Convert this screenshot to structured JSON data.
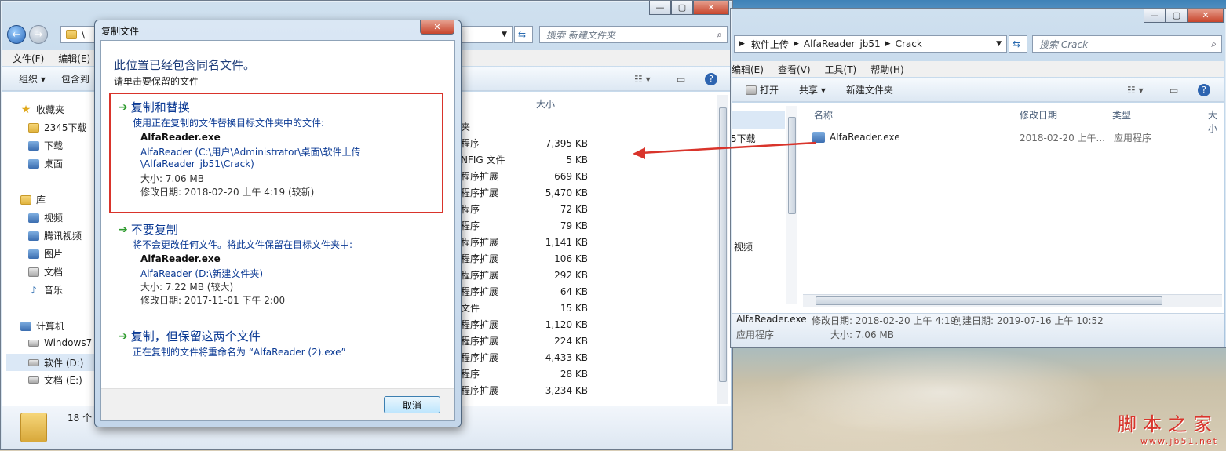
{
  "left_window": {
    "address_partial": "\\",
    "search_placeholder": "搜索 新建文件夹",
    "menu": [
      "文件(F)",
      "编辑(E)"
    ],
    "toolbar": {
      "organize": "组织 ▾",
      "include": "包含到"
    },
    "nav": {
      "favorites": "收藏夹",
      "fav_items": [
        "2345下载",
        "下载",
        "桌面"
      ],
      "library": "库",
      "lib_items": [
        "视频",
        "腾讯视频",
        "图片",
        "文档",
        "音乐"
      ],
      "computer": "计算机",
      "drives": [
        "Windows7",
        "软件 (D:)",
        "文档 (E:)"
      ]
    },
    "size_header": "大小",
    "rows": [
      {
        "type": "夹",
        "size": ""
      },
      {
        "type": "程序",
        "size": "7,395 KB"
      },
      {
        "type": "NFIG 文件",
        "size": "5 KB"
      },
      {
        "type": "程序扩展",
        "size": "669 KB"
      },
      {
        "type": "程序扩展",
        "size": "5,470 KB"
      },
      {
        "type": "程序",
        "size": "72 KB"
      },
      {
        "type": "程序",
        "size": "79 KB"
      },
      {
        "type": "程序扩展",
        "size": "1,141 KB"
      },
      {
        "type": "程序扩展",
        "size": "106 KB"
      },
      {
        "type": "程序扩展",
        "size": "292 KB"
      },
      {
        "type": "程序扩展",
        "size": "64 KB"
      },
      {
        "type": "文件",
        "size": "15 KB"
      },
      {
        "type": "程序扩展",
        "size": "1,120 KB"
      },
      {
        "type": "程序扩展",
        "size": "224 KB"
      },
      {
        "type": "程序扩展",
        "size": "4,433 KB"
      },
      {
        "type": "程序",
        "size": "28 KB"
      },
      {
        "type": "程序扩展",
        "size": "3,234 KB"
      }
    ],
    "status_count": "18 个"
  },
  "dialog": {
    "title": "复制文件",
    "heading": "此位置已经包含同名文件。",
    "subheading": "请单击要保留的文件",
    "option1": {
      "title": "复制和替换",
      "desc": "使用正在复制的文件替换目标文件夹中的文件:",
      "filename": "AlfaReader.exe",
      "path1": "AlfaReader (C:\\用户\\Administrator\\桌面\\软件上传",
      "path2": "\\AlfaReader_jb51\\Crack)",
      "size": "大小: 7.06 MB",
      "date": "修改日期: 2018-02-20 上午 4:19 (较新)"
    },
    "option2": {
      "title": "不要复制",
      "desc": "将不会更改任何文件。将此文件保留在目标文件夹中:",
      "filename": "AlfaReader.exe",
      "path": "AlfaReader (D:\\新建文件夹)",
      "size": "大小: 7.22 MB (较大)",
      "date": "修改日期: 2017-11-01 下午 2:00"
    },
    "option3": {
      "title": "复制，但保留这两个文件",
      "desc": "正在复制的文件将重命名为 “AlfaReader (2).exe”"
    },
    "cancel": "取消"
  },
  "right_window": {
    "breadcrumb": [
      "软件上传",
      "AlfaReader_jb51",
      "Crack"
    ],
    "search_placeholder": "搜索 Crack",
    "menu": [
      "编辑(E)",
      "查看(V)",
      "工具(T)",
      "帮助(H)"
    ],
    "toolbar": {
      "open": "打开",
      "share": "共享 ▾",
      "new_folder": "新建文件夹"
    },
    "nav": [
      "5下载",
      "视频"
    ],
    "columns": {
      "name": "名称",
      "date": "修改日期",
      "type": "类型",
      "size": "大小"
    },
    "file": {
      "name": "AlfaReader.exe",
      "date": "2018-02-20 上午...",
      "type": "应用程序"
    },
    "details": {
      "name": "AlfaReader.exe",
      "modified": "修改日期: 2018-02-20 上午 4:19",
      "created": "创建日期: 2019-07-16 上午 10:52",
      "type": "应用程序",
      "size": "大小: 7.06 MB"
    }
  },
  "watermark": {
    "brand": "脚本之家",
    "url": "www.jb51.net"
  },
  "colors": {
    "highlight": "#d9342b",
    "link": "#0b3a94",
    "arrow": "#d9342b"
  }
}
